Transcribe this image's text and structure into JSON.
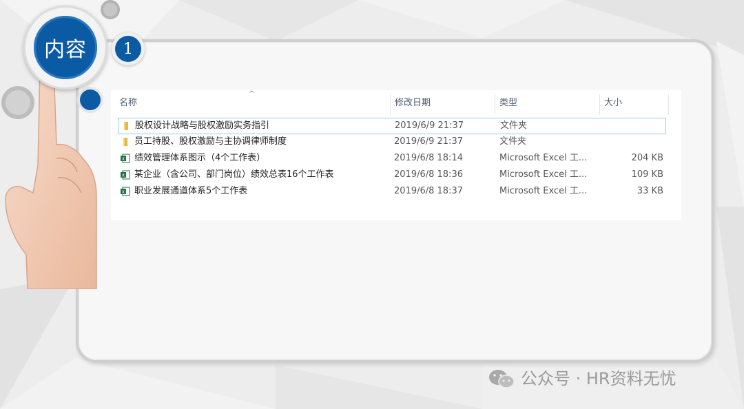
{
  "slide": {
    "title": "内容",
    "number": "1"
  },
  "explorer": {
    "columns": [
      "名称",
      "修改日期",
      "类型",
      "大小"
    ],
    "sort_indicator": "^",
    "files": [
      {
        "name": "股权设计战略与股权激励实务指引",
        "date": "2019/6/9 21:37",
        "type": "文件夹",
        "size": "",
        "icon": "folder-icon",
        "selected": true
      },
      {
        "name": "员工持股、股权激励与主协调律师制度",
        "date": "2019/6/9 21:37",
        "type": "文件夹",
        "size": "",
        "icon": "folder-icon",
        "selected": false
      },
      {
        "name": "绩效管理体系图示（4个工作表）",
        "date": "2019/6/8 18:14",
        "type": "Microsoft Excel 工...",
        "size": "204 KB",
        "icon": "excel-icon",
        "selected": false
      },
      {
        "name": "某企业（含公司、部门岗位）绩效总表16个工作表",
        "date": "2019/6/8 18:36",
        "type": "Microsoft Excel 工...",
        "size": "109 KB",
        "icon": "excel-icon",
        "selected": false
      },
      {
        "name": "职业发展通道体系5个工作表",
        "date": "2019/6/8 18:37",
        "type": "Microsoft Excel 工...",
        "size": "33 KB",
        "icon": "excel-icon",
        "selected": false
      }
    ]
  },
  "watermark": {
    "text": "公众号 · HR资料无忧",
    "icon": "wechat-icon"
  },
  "colors": {
    "accent_blue": "#0b5aa4",
    "folder_yellow": "#e8b83b",
    "excel_green": "#1e7145",
    "selection_border": "#99c9ef"
  }
}
